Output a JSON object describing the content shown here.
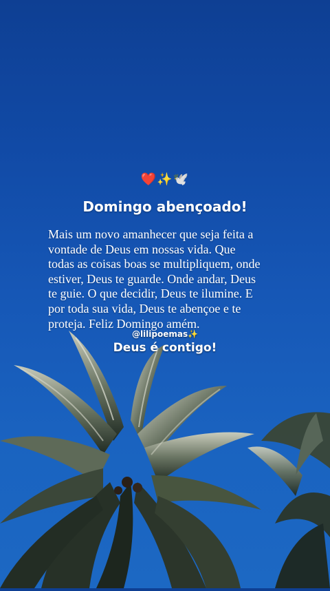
{
  "post": {
    "emoji": {
      "heart": "❤️",
      "sparkles": "✨",
      "dove": "🕊️"
    },
    "title": "Domingo abençoado!",
    "body_lines": [
      "Mais um novo amanhecer que seja feita a",
      "vontade de Deus em nossas vida. Que",
      "todas as coisas boas se multipliquem, onde",
      "estiver, Deus te guarde. Onde andar, Deus",
      "te guie. O que decidir, Deus te ilumine. E",
      "por toda sua vida, Deus te abençoe e te",
      "proteja. Feliz Domingo amém."
    ],
    "handle": "@lilipoemas",
    "handle_emoji": "✨",
    "closing": "Deus é contigo!"
  },
  "background": {
    "sky_top": "#0e3f93",
    "sky_bottom": "#1c68c3",
    "palm_dark": "#1f2a22",
    "palm_frond": "#3a4a36",
    "palm_highlight": "#c8c9b8"
  }
}
